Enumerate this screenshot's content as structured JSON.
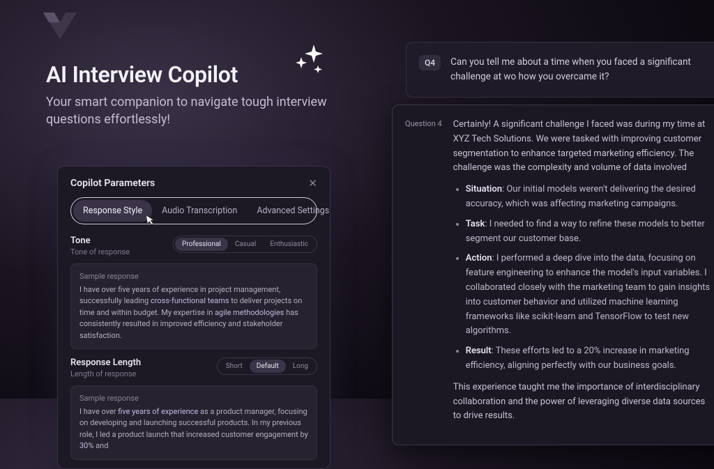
{
  "hero": {
    "title": "AI Interview Copilot",
    "subtitle": "Your smart companion to navigate tough interview questions effortlessly!"
  },
  "panel": {
    "title": "Copilot Parameters",
    "tabs": [
      "Response Style",
      "Audio Transcription",
      "Advanced Settings"
    ],
    "active_tab": 0,
    "tone": {
      "title": "Tone",
      "subtitle": "Tone of response",
      "options": [
        "Professional",
        "Casual",
        "Enthusiastic"
      ],
      "active": 0,
      "sample_label": "Sample response",
      "sample_parts": {
        "a": "I have over five years of experience in project management, successfully leading ",
        "hl1": "cross-functional teams",
        "b": " to deliver projects on time and within budget. My expertise in ",
        "hl2": "agile methodologies",
        "c": " has consistently resulted in improved efficiency and stakeholder satisfaction."
      }
    },
    "length": {
      "title": "Response Length",
      "subtitle": "Length of response",
      "options": [
        "Short",
        "Default",
        "Long"
      ],
      "active": 1,
      "sample_label": "Sample response",
      "sample_parts": {
        "a": "I have over ",
        "hl1": "five years of experience",
        "b": " as a product manager, focusing on developing and launching successful products. In my previous role, I led a product launch that increased customer engagement by ",
        "hl2": "30%",
        "c": " and"
      }
    }
  },
  "qa": {
    "badge": "Q4",
    "question": "Can you tell me about a time when you faced a significant challenge at wo how you overcame it?",
    "answer_label": "Question 4",
    "answer_intro": "Certainly! A significant challenge I faced was during my time at XYZ Tech Solutions. We were tasked with improving customer segmentation to enhance targeted marketing efficiency. The challenge was the complexity and volume of data involved",
    "bullets": [
      {
        "label": "Situation",
        "text": "Our initial models weren't delivering the desired accuracy, which was affecting marketing campaigns."
      },
      {
        "label": "Task",
        "text": "I needed to find a way to refine these models to better segment our customer base."
      },
      {
        "label": "Action",
        "text": "I performed a deep dive into the data, focusing on feature engineering to enhance the model's input variables. I collaborated closely with the marketing team to gain insights into customer behavior and utilized machine learning frameworks like scikit-learn and TensorFlow to test new algorithms."
      },
      {
        "label": "Result",
        "text": "These efforts led to a 20% increase in marketing efficiency, aligning perfectly with our business goals."
      }
    ],
    "answer_outro": "This experience taught me the importance of interdisciplinary collaboration and the power of leveraging diverse data sources to drive results."
  }
}
